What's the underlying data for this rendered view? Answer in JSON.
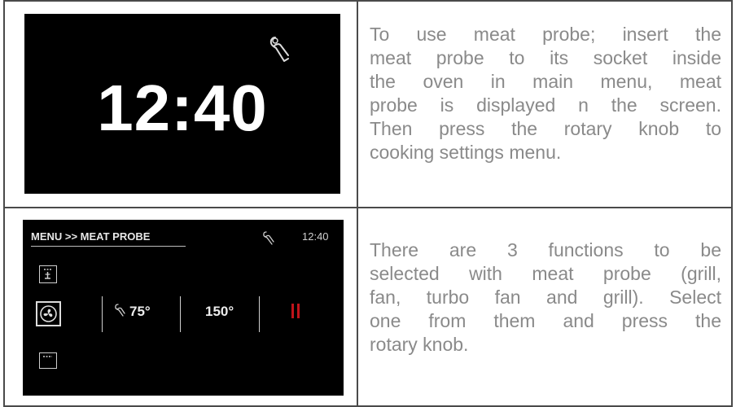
{
  "row1": {
    "screen": {
      "time": "12:40",
      "icon": "meat-probe-icon"
    },
    "text_lines": [
      "To use meat probe; insert the",
      "meat probe to its socket inside",
      "the oven in main menu, meat",
      "probe is displayed n the screen.",
      "Then press the rotary knob to",
      "cooking settings menu."
    ]
  },
  "row2": {
    "screen": {
      "header": "MENU >> MEAT PROBE",
      "time": "12:40",
      "probe_temp": "75°",
      "oven_temp": "150°",
      "icons": [
        "grill-icon",
        "fan-icon",
        "turbo-fan-grill-icon",
        "meat-probe-icon",
        "pause-icon"
      ],
      "pause_color": "#c0141a"
    },
    "text_lines": [
      "There are 3 functions to be",
      "selected with meat probe (grill,",
      "fan, turbo fan and grill). Select",
      "one from them and press the",
      "rotary knob."
    ]
  }
}
